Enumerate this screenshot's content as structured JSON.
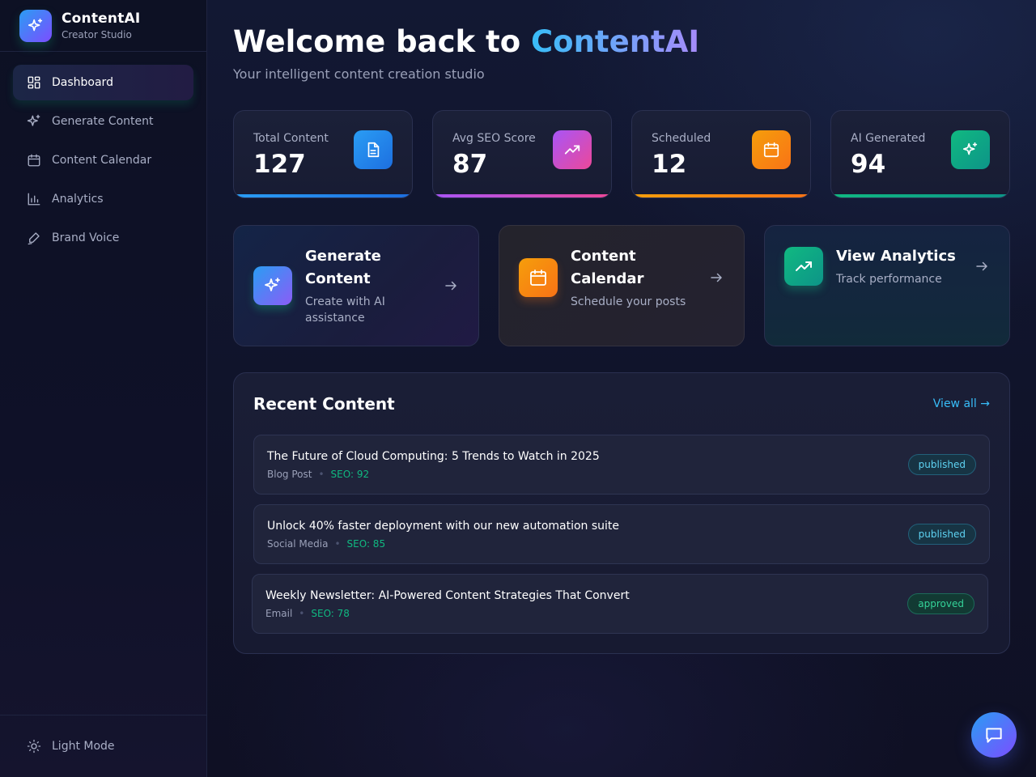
{
  "brand": {
    "name": "ContentAI",
    "subtitle": "Creator Studio",
    "logo_icon": "sparkles-icon"
  },
  "sidebar": {
    "items": [
      {
        "label": "Dashboard",
        "icon": "dashboard-icon",
        "active": true
      },
      {
        "label": "Generate Content",
        "icon": "sparkles-icon",
        "active": false
      },
      {
        "label": "Content Calendar",
        "icon": "calendar-icon",
        "active": false
      },
      {
        "label": "Analytics",
        "icon": "bar-chart-icon",
        "active": false
      },
      {
        "label": "Brand Voice",
        "icon": "pen-icon",
        "active": false
      }
    ],
    "footer": {
      "label": "Light Mode",
      "icon": "sun-icon"
    }
  },
  "header": {
    "title_prefix": "Welcome back to ",
    "title_accent": "ContentAI",
    "subtitle": "Your intelligent content creation studio"
  },
  "stats": [
    {
      "label": "Total Content",
      "value": "127",
      "icon": "document-icon",
      "color_from": "#2a9df4",
      "color_to": "#1d6fe0"
    },
    {
      "label": "Avg SEO Score",
      "value": "87",
      "icon": "trending-up-icon",
      "color_from": "#a855f7",
      "color_to": "#ec4899"
    },
    {
      "label": "Scheduled",
      "value": "12",
      "icon": "calendar-icon",
      "color_from": "#f59e0b",
      "color_to": "#f97316"
    },
    {
      "label": "AI Generated",
      "value": "94",
      "icon": "sparkles-icon",
      "color_from": "#10b981",
      "color_to": "#0d9488"
    }
  ],
  "actions": [
    {
      "title_line1": "Generate",
      "title_line2": "Content",
      "sub_line1": "Create with AI",
      "sub_line2": "assistance",
      "icon": "sparkles-icon"
    },
    {
      "title_line1": "Content",
      "title_line2": "Calendar",
      "sub_line1": "Schedule your posts",
      "icon": "calendar-icon"
    },
    {
      "title_line1": "View Analytics",
      "sub_line1": "Track performance",
      "icon": "trending-up-icon"
    }
  ],
  "recent": {
    "title": "Recent Content",
    "view_all": "View all →",
    "items": [
      {
        "title": "The Future of Cloud Computing: 5 Trends to Watch in 2025",
        "type": "Blog Post",
        "seo": "SEO: 92",
        "status": "published"
      },
      {
        "title": "Unlock 40% faster deployment with our new automation suite",
        "type": "Social Media",
        "seo": "SEO: 85",
        "status": "published"
      },
      {
        "title": "Weekly Newsletter: AI-Powered Content Strategies That Convert",
        "type": "Email",
        "seo": "SEO: 78",
        "status": "approved"
      }
    ]
  },
  "chat": {
    "icon": "chat-icon"
  }
}
